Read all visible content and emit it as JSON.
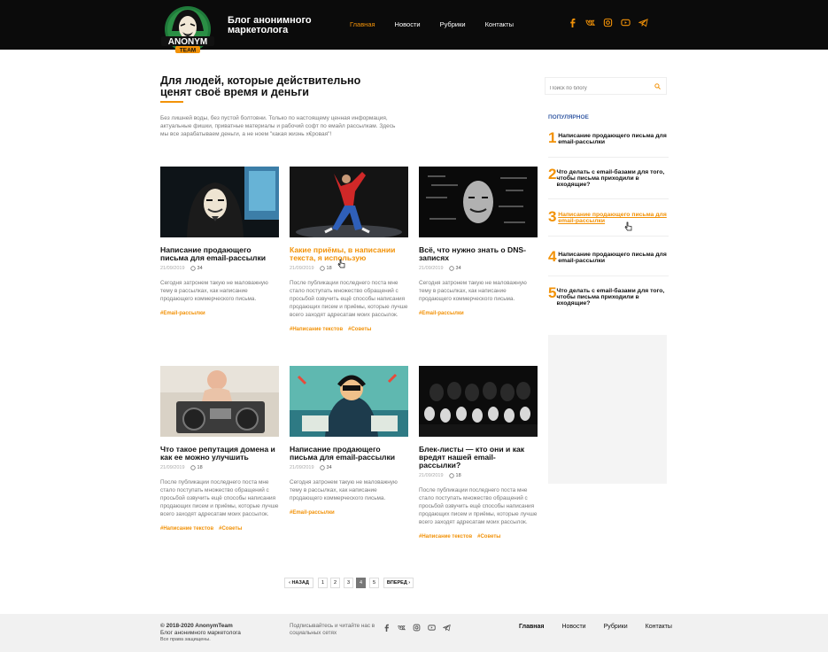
{
  "header": {
    "logo_text": "ANONYM TEAM",
    "title": "Блог анонимного маркетолога",
    "nav": [
      {
        "label": "Главная",
        "active": true
      },
      {
        "label": "Новости",
        "active": false
      },
      {
        "label": "Рубрики",
        "active": false
      },
      {
        "label": "Контакты",
        "active": false
      }
    ],
    "socials": [
      "facebook-icon",
      "vk-icon",
      "instagram-icon",
      "youtube-icon",
      "telegram-icon"
    ]
  },
  "hero": {
    "title": "Для людей, которые действительно ценят своё время и деньги",
    "description": "Без лишней воды, без пустой болтовни. Только по настоящему ценная информация, актуальные фишки, приватные материалы и рабочий софт по емайл рассылкам. Здесь мы все зарабатываем деньги, а не ноем \"какая жизнь х€ровая\"!"
  },
  "posts": [
    {
      "title": "Написание продающего письма для email-рассылки",
      "date": "21/09/2019",
      "comments": "34",
      "excerpt": "Сегодня затронем такую не маловажную тему в рассылках, как написание продающего коммерческого письма.",
      "tags": [
        "#Email-рассылки"
      ],
      "image": "hacker-mask-image"
    },
    {
      "title": "Какие приёмы, в написании текста, я использую",
      "date": "21/09/2019",
      "comments": "18",
      "excerpt": "После публикации последнего поста мне стало поступать множество обращений с просьбой озвучить ещё способы написания продающих писем и приёмы, которые лучше всего заходят адресатам моих рассылок.",
      "tags": [
        "#Написание текстов",
        "#Советы"
      ],
      "image": "breakdancer-image"
    },
    {
      "title": "Всё, что нужно знать о DNS-записях",
      "date": "21/09/2019",
      "comments": "34",
      "excerpt": "Сегодня затронем такую не маловажную тему в рассылках, как написание продающего коммерческого письма.",
      "tags": [
        "#Email-рассылки"
      ],
      "image": "digital-mask-image"
    },
    {
      "title": "Что такое репутация домена и как ее можно улучшить",
      "date": "21/09/2019",
      "comments": "18",
      "excerpt": "После публикации последнего поста мне стало поступать множество обращений с просьбой озвучить ещё способы написания продающих писем и приёмы, которые лучше всего заходят адресатам моих рассылок.",
      "tags": [
        "#Написание текстов",
        "#Советы"
      ],
      "image": "baby-boombox-image"
    },
    {
      "title": "Написание продающего письма для email-рассылки",
      "date": "21/09/2019",
      "comments": "34",
      "excerpt": "Сегодня затронем такую не маловажную тему в рассылках, как написание продающего коммерческого письма.",
      "tags": [
        "#Email-рассылки"
      ],
      "image": "comic-hacker-image"
    },
    {
      "title": "Блек-листы — кто они и как вредят нашей email-рассылки?",
      "date": "21/09/2019",
      "comments": "18",
      "excerpt": "После публикации последнего поста мне стало поступать множество обращений с просьбой озвучить ещё способы написания продающих писем и приёмы, которые лучше всего заходят адресатам моих рассылок.",
      "tags": [
        "#Написание текстов",
        "#Советы"
      ],
      "image": "crowd-masks-image"
    }
  ],
  "sidebar": {
    "search_placeholder": "Поиск по блогу",
    "popular_title": "ПОПУЛЯРНОЕ",
    "popular": [
      {
        "num": "1",
        "title": "Написание продающего письма для email-рассылки"
      },
      {
        "num": "2",
        "title": "Что делать с email-базами для того, чтобы письма приходили в входящие?"
      },
      {
        "num": "3",
        "title": "Написание продающего письма для email-рассылки"
      },
      {
        "num": "4",
        "title": "Написание продающего письма для email-рассылки"
      },
      {
        "num": "5",
        "title": "Что делать с email-базами для того, чтобы письма приходили в входящие?"
      }
    ]
  },
  "pagination": {
    "prev": "‹ НАЗАД",
    "pages": [
      "1",
      "2",
      "3",
      "4",
      "5"
    ],
    "current": "4",
    "next": "ВПЕРЕД ›"
  },
  "footer": {
    "copyright": "© 2018-2020 AnonymTeam",
    "blog_name": "Блог анонимного маркетолога",
    "rights": "Все права защищены.",
    "subscribe": "Подписывайтесь и читайте нас в социальных сетях",
    "nav": [
      "Главная",
      "Новости",
      "Рубрики",
      "Контакты"
    ]
  },
  "colors": {
    "accent": "#f29208",
    "header_bg": "#0b0b0b",
    "popular_title": "#3a5ea6"
  }
}
